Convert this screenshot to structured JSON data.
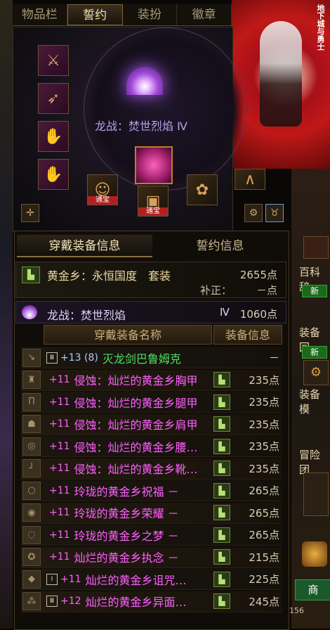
{
  "tabs": [
    "物品栏",
    "誓约",
    "装扮",
    "徽章"
  ],
  "active_tab": "誓约",
  "weapon_title": "龙战：焚世烈焰 Ⅳ",
  "bao_label": "通宝",
  "sub_tabs": [
    "穿戴装备信息",
    "誓约信息"
  ],
  "set_bonus": {
    "name": "黄金乡：永恒国度　套装",
    "points": "2655点",
    "adjust_label": "补正：",
    "adjust_value": "－点"
  },
  "pledge": {
    "name": "龙战：焚世烈焰",
    "tier": "Ⅳ",
    "points": "1060点"
  },
  "table_headers": {
    "name": "穿戴装备名称",
    "info": "装备信息"
  },
  "equipment": [
    {
      "icon": "sword-icon",
      "tier": "Ⅲ",
      "plus": "+13 (8)",
      "name": "灭龙剑巴鲁姆克",
      "points": "－",
      "color": "#4ee060",
      "plus_color": "#b0c8ff",
      "has_set": false
    },
    {
      "icon": "chest-armor-icon",
      "tier": "",
      "plus": "+11",
      "name": "侵蚀：灿烂的黄金乡胸甲",
      "points": "235点",
      "color": "#ff60ff",
      "plus_color": "#ff60ff",
      "has_set": true
    },
    {
      "icon": "leg-armor-icon",
      "tier": "",
      "plus": "+11",
      "name": "侵蚀：灿烂的黄金乡腿甲",
      "points": "235点",
      "color": "#ff60ff",
      "plus_color": "#ff60ff",
      "has_set": true
    },
    {
      "icon": "shoulder-armor-icon",
      "tier": "",
      "plus": "+11",
      "name": "侵蚀：灿烂的黄金乡肩甲",
      "points": "235点",
      "color": "#ff60ff",
      "plus_color": "#ff60ff",
      "has_set": true
    },
    {
      "icon": "belt-icon",
      "tier": "",
      "plus": "+11",
      "name": "侵蚀：灿烂的黄金乡腰…",
      "points": "235点",
      "color": "#ff60ff",
      "plus_color": "#ff60ff",
      "has_set": true
    },
    {
      "icon": "boots-icon",
      "tier": "",
      "plus": "+11",
      "name": "侵蚀：灿烂的黄金乡靴…",
      "points": "235点",
      "color": "#ff60ff",
      "plus_color": "#ff60ff",
      "has_set": true
    },
    {
      "icon": "necklace-icon",
      "tier": "",
      "plus": "+11",
      "name": "玲珑的黄金乡祝福 －",
      "points": "265点",
      "color": "#ff60ff",
      "plus_color": "#ff60ff",
      "has_set": true
    },
    {
      "icon": "bracelet-icon",
      "tier": "",
      "plus": "+11",
      "name": "玲珑的黄金乡荣耀 －",
      "points": "265点",
      "color": "#ff60ff",
      "plus_color": "#ff60ff",
      "has_set": true
    },
    {
      "icon": "ring-icon",
      "tier": "",
      "plus": "+11",
      "name": "玲珑的黄金乡之梦 －",
      "points": "265点",
      "color": "#ff60ff",
      "plus_color": "#ff60ff",
      "has_set": true
    },
    {
      "icon": "support-icon",
      "tier": "",
      "plus": "+11",
      "name": "灿烂的黄金乡执念 －",
      "points": "215点",
      "color": "#ff60ff",
      "plus_color": "#ff60ff",
      "has_set": true
    },
    {
      "icon": "magic-stone-icon",
      "tier": "Ⅰ",
      "plus": "+11",
      "name": "灿烂的黄金乡诅咒…",
      "points": "225点",
      "color": "#ff60ff",
      "plus_color": "#ff60ff",
      "has_set": true
    },
    {
      "icon": "earring-icon",
      "tier": "Ⅲ",
      "plus": "+12",
      "name": "灿烂的黄金乡异面…",
      "points": "245点",
      "color": "#ff60ff",
      "plus_color": "#ff60ff",
      "has_set": true
    }
  ],
  "right_side": {
    "labels": [
      "百科辞",
      "装备回",
      "装备模",
      "冒险团",
      "商"
    ],
    "new_badge": "新"
  },
  "banner_text": "地下城与勇士",
  "bottom_number": "156"
}
